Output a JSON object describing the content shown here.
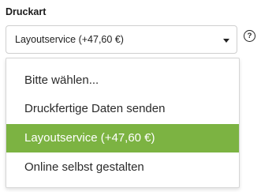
{
  "field": {
    "label": "Druckart",
    "selected_value": "Layoutservice (+47,60 €)"
  },
  "help": {
    "glyph": "?",
    "icon": "help-circle-icon"
  },
  "dropdown": {
    "options": [
      {
        "label": "Bitte wählen..."
      },
      {
        "label": "Druckfertige Daten senden"
      },
      {
        "label": "Layoutservice (+47,60 €)",
        "selected": true
      },
      {
        "label": "Online selbst gestalten"
      }
    ]
  },
  "colors": {
    "selected_background": "#7cb342",
    "selected_text": "#ffffff"
  }
}
